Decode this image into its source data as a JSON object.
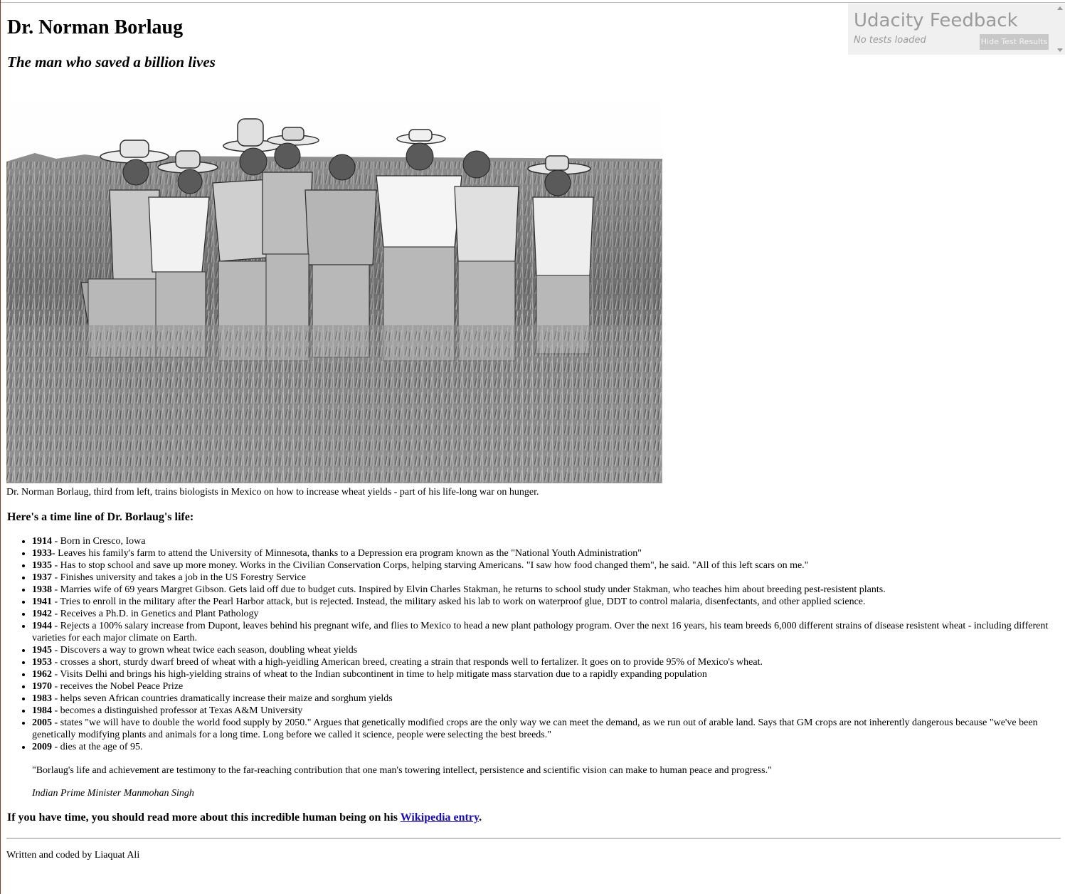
{
  "page": {
    "title": "Dr. Norman Borlaug",
    "subtitle": "The man who saved a billion lives",
    "image_alt": "Dr. Norman Borlaug, third from left, trains biologists in Mexico on how to increase wheat yields - part of his life-long war on hunger.",
    "caption": "Dr. Norman Borlaug, third from left, trains biologists in Mexico on how to increase wheat yields - part of his life-long war on hunger.",
    "timeline_heading": "Here's a time line of Dr. Borlaug's life:",
    "timeline": [
      {
        "year": "1914",
        "sep": " - ",
        "text": "Born in Cresco, Iowa"
      },
      {
        "year": "1933",
        "sep": "- ",
        "text": "Leaves his family's farm to attend the University of Minnesota, thanks to a Depression era program known as the \"National Youth Administration\""
      },
      {
        "year": "1935",
        "sep": " - ",
        "text": "Has to stop school and save up more money. Works in the Civilian Conservation Corps, helping starving Americans. \"I saw how food changed them\", he said. \"All of this left scars on me.\""
      },
      {
        "year": "1937",
        "sep": " - ",
        "text": "Finishes university and takes a job in the US Forestry Service"
      },
      {
        "year": "1938",
        "sep": " - ",
        "text": "Marries wife of 69 years Margret Gibson. Gets laid off due to budget cuts. Inspired by Elvin Charles Stakman, he returns to school study under Stakman, who teaches him about breeding pest-resistent plants."
      },
      {
        "year": "1941",
        "sep": " - ",
        "text": "Tries to enroll in the military after the Pearl Harbor attack, but is rejected. Instead, the military asked his lab to work on waterproof glue, DDT to control malaria, disenfectants, and other applied science."
      },
      {
        "year": "1942",
        "sep": " - ",
        "text": "Receives a Ph.D. in Genetics and Plant Pathology"
      },
      {
        "year": "1944",
        "sep": " - ",
        "text": "Rejects a 100% salary increase from Dupont, leaves behind his pregnant wife, and flies to Mexico to head a new plant pathology program. Over the next 16 years, his team breeds 6,000 different strains of disease resistent wheat - including different varieties for each major climate on Earth."
      },
      {
        "year": "1945",
        "sep": " - ",
        "text": "Discovers a way to grown wheat twice each season, doubling wheat yields"
      },
      {
        "year": "1953",
        "sep": " - ",
        "text": "crosses a short, sturdy dwarf breed of wheat with a high-yeidling American breed, creating a strain that responds well to fertalizer. It goes on to provide 95% of Mexico's wheat."
      },
      {
        "year": "1962",
        "sep": " - ",
        "text": "Visits Delhi and brings his high-yielding strains of wheat to the Indian subcontinent in time to help mitigate mass starvation due to a rapidly expanding population"
      },
      {
        "year": "1970",
        "sep": " - ",
        "text": "receives the Nobel Peace Prize"
      },
      {
        "year": "1983",
        "sep": " - ",
        "text": "helps seven African countries dramatically increase their maize and sorghum yields"
      },
      {
        "year": "1984",
        "sep": " - ",
        "text": "becomes a distinguished professor at Texas A&M University"
      },
      {
        "year": "2005",
        "sep": " - ",
        "text": "states \"we will have to double the world food supply by 2050.\" Argues that genetically modified crops are the only way we can meet the demand, as we run out of arable land. Says that GM crops are not inherently dangerous because \"we've been genetically modifying plants and animals for a long time. Long before we called it science, people were selecting the best breeds.\""
      },
      {
        "year": "2009",
        "sep": " - ",
        "text": "dies at the age of 95."
      }
    ],
    "quote": "\"Borlaug's life and achievement are testimony to the far-reaching contribution that one man's towering intellect, persistence and scientific vision can make to human peace and progress.\"",
    "quote_author": "Indian Prime Minister Manmohan Singh",
    "more_prefix": "If you have time, you should read more about this incredible human being on his ",
    "more_link": "Wikipedia entry",
    "more_suffix": ".",
    "footer": "Written and coded by Liaquat Ali"
  },
  "udacity": {
    "title": "Udacity Feedback",
    "status": "No tests loaded",
    "hide_button": "Hide Test Results"
  },
  "colors": {
    "link": "#1a0dab",
    "widget_bg": "#f0f0f0",
    "widget_text": "#9a9a9a",
    "widget_button": "#c8c8c8"
  }
}
